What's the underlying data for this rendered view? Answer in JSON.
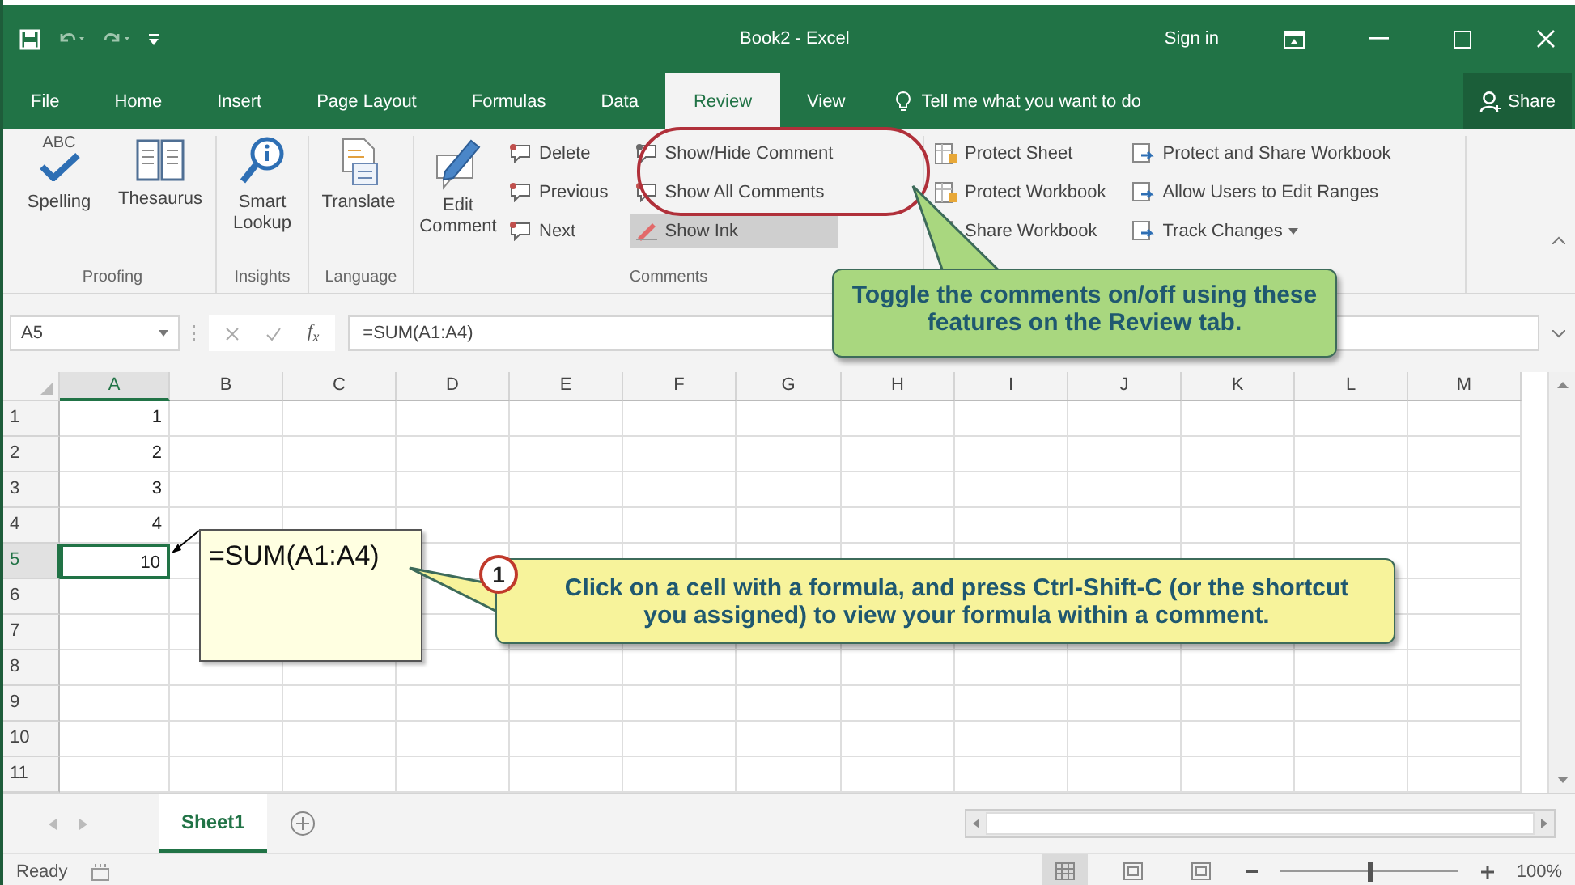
{
  "title_bar": {
    "title": "Book2 - Excel",
    "sign_in": "Sign in"
  },
  "menu_tabs": [
    {
      "label": "File",
      "selected": false
    },
    {
      "label": "Home",
      "selected": false
    },
    {
      "label": "Insert",
      "selected": false
    },
    {
      "label": "Page Layout",
      "selected": false
    },
    {
      "label": "Formulas",
      "selected": false
    },
    {
      "label": "Data",
      "selected": false
    },
    {
      "label": "Review",
      "selected": true
    },
    {
      "label": "View",
      "selected": false
    }
  ],
  "tell_me": "Tell me what you want to do",
  "share": "Share",
  "ribbon": {
    "groups": [
      {
        "label": "Proofing",
        "columns": [
          {
            "kind": "large",
            "items": [
              {
                "label": "Spelling",
                "icon_text": "ABC"
              }
            ]
          },
          {
            "kind": "large",
            "items": [
              {
                "label": "Thesaurus"
              }
            ]
          }
        ]
      },
      {
        "label": "Insights",
        "columns": [
          {
            "kind": "large",
            "items": [
              {
                "label": "Smart Lookup"
              }
            ]
          }
        ]
      },
      {
        "label": "Language",
        "columns": [
          {
            "kind": "large",
            "items": [
              {
                "label": "Translate"
              }
            ]
          }
        ]
      },
      {
        "label": "Comments",
        "columns": [
          {
            "kind": "large",
            "items": [
              {
                "label": "Edit Comment"
              }
            ]
          },
          {
            "kind": "small",
            "items": [
              {
                "label": "Delete"
              },
              {
                "label": "Previous"
              },
              {
                "label": "Next"
              }
            ]
          },
          {
            "kind": "small",
            "items": [
              {
                "label": "Show/Hide Comment"
              },
              {
                "label": "Show All Comments"
              },
              {
                "label": "Show Ink",
                "on": true
              }
            ]
          }
        ]
      },
      {
        "columns": [
          {
            "kind": "small",
            "items": [
              {
                "label": "Protect Sheet"
              },
              {
                "label": "Protect Workbook"
              },
              {
                "label": "Share Workbook"
              }
            ]
          },
          {
            "kind": "small",
            "items": [
              {
                "label": "Protect and Share Workbook"
              },
              {
                "label": "Allow Users to Edit Ranges"
              },
              {
                "label": "Track Changes",
                "dropdown": true
              }
            ]
          }
        ]
      }
    ]
  },
  "formula_bar": {
    "name_box": "A5",
    "function_label": "f$_{x}$",
    "formula": "=SUM(A1:A4)"
  },
  "columns": [
    {
      "label": "A",
      "selected": true
    },
    {
      "label": "B",
      "selected": false
    },
    {
      "label": "C",
      "selected": false
    },
    {
      "label": "D",
      "selected": false
    },
    {
      "label": "E",
      "selected": false
    },
    {
      "label": "F",
      "selected": false
    },
    {
      "label": "G",
      "selected": false
    },
    {
      "label": "H",
      "selected": false
    },
    {
      "label": "I",
      "selected": false
    },
    {
      "label": "J",
      "selected": false
    },
    {
      "label": "K",
      "selected": false
    },
    {
      "label": "L",
      "selected": false
    },
    {
      "label": "M",
      "selected": false
    }
  ],
  "rows": [
    {
      "label": "1",
      "selected": false,
      "cells": [
        {
          "value": "1",
          "selected": false
        }
      ]
    },
    {
      "label": "2",
      "selected": false,
      "cells": [
        {
          "value": "2",
          "selected": false
        }
      ]
    },
    {
      "label": "3",
      "selected": false,
      "cells": [
        {
          "value": "3",
          "selected": false
        }
      ]
    },
    {
      "label": "4",
      "selected": false,
      "cells": [
        {
          "value": "4",
          "selected": false
        }
      ]
    },
    {
      "label": "5",
      "selected": true,
      "cells": [
        {
          "value": "10",
          "selected": true
        }
      ]
    },
    {
      "label": "6",
      "selected": false,
      "cells": []
    },
    {
      "label": "7",
      "selected": false,
      "cells": []
    },
    {
      "label": "8",
      "selected": false,
      "cells": []
    },
    {
      "label": "9",
      "selected": false,
      "cells": []
    },
    {
      "label": "10",
      "selected": false,
      "cells": []
    },
    {
      "label": "11",
      "selected": false,
      "cells": []
    }
  ],
  "comment": {
    "text": "=SUM(A1:A4)"
  },
  "callouts": [
    {
      "kind": "green",
      "text": "Toggle the comments on/off using these features on the Review tab."
    },
    {
      "kind": "yellow",
      "number": "1",
      "text": "Click on a cell with a formula, and press Ctrl-Shift-C (or the shortcut you assigned) to view your formula within a comment."
    }
  ],
  "sheet_tabs": [
    {
      "label": "Sheet1",
      "selected": true
    }
  ],
  "status_bar": {
    "status": "Ready",
    "view_buttons": [
      {
        "selected": true
      },
      {
        "selected": false
      },
      {
        "selected": false
      }
    ],
    "zoom_slider": {
      "level": 0.5
    },
    "zoom": "100%"
  }
}
